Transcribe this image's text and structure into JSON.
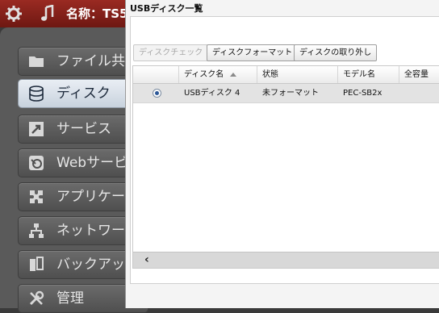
{
  "topbar": {
    "gear_icon": "gear-icon",
    "music_icon": "music-icon",
    "title": "名称：TS5"
  },
  "sidebar": {
    "items": [
      {
        "label": "ファイル共",
        "icon": "folder-icon",
        "active": false
      },
      {
        "label": "ディスク",
        "icon": "disk-icon",
        "active": true
      },
      {
        "label": "サービス",
        "icon": "service-icon",
        "active": false
      },
      {
        "label": "Webサービ",
        "icon": "web-icon",
        "active": false
      },
      {
        "label": "アプリケー",
        "icon": "puzzle-icon",
        "active": false
      },
      {
        "label": "ネットワー",
        "icon": "network-icon",
        "active": false
      },
      {
        "label": "バックアッ",
        "icon": "backup-icon",
        "active": false
      },
      {
        "label": "管理",
        "icon": "tools-icon",
        "active": false
      }
    ]
  },
  "dialog": {
    "title": "USBディスク一覧",
    "buttons": {
      "disk_check": "ディスクチェック",
      "disk_format": "ディスクフォーマット",
      "disk_remove": "ディスクの取り外し"
    },
    "table": {
      "columns": [
        "",
        "ディスク名",
        "状態",
        "モデル名",
        "全容量"
      ],
      "rows": [
        {
          "selected": true,
          "name": "USBディスク 4",
          "status": "未フォーマット",
          "model": "PEC-SB2x",
          "capacity": ""
        }
      ]
    },
    "scroll_left": "‹"
  },
  "colors": {
    "topbar": "#8a231c",
    "sidebar_bg": "#5a5a5a",
    "active_item": "#dfe6ee",
    "selected_row": "#e3e3e3"
  }
}
